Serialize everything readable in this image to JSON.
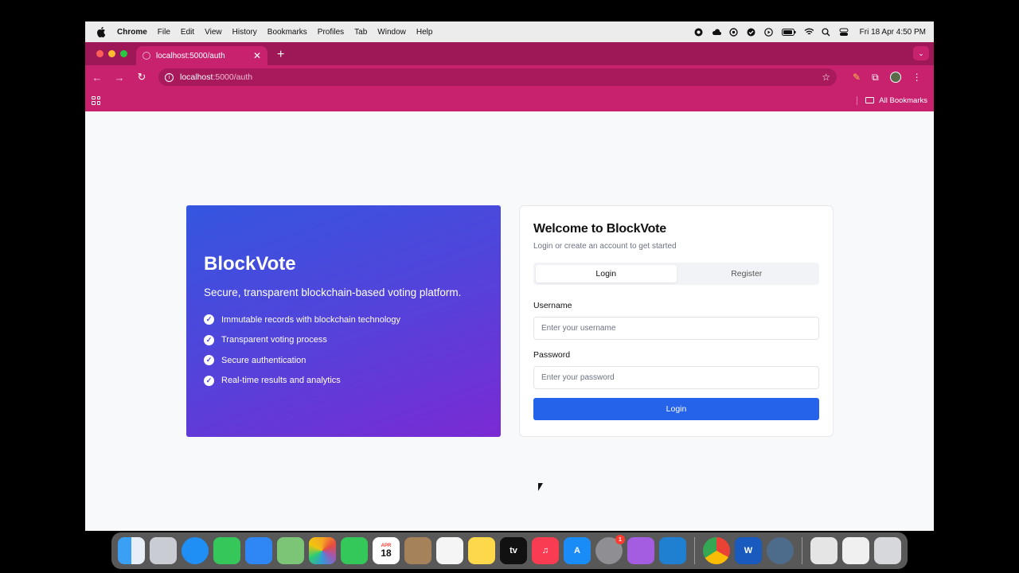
{
  "menubar": {
    "app_name": "Chrome",
    "items": [
      "File",
      "Edit",
      "View",
      "History",
      "Bookmarks",
      "Profiles",
      "Tab",
      "Window",
      "Help"
    ],
    "clock": "Fri 18 Apr  4:50 PM"
  },
  "browser": {
    "tab_title": "localhost:5000/auth",
    "url_host": "localhost",
    "url_path": ":5000/auth",
    "bookmarks_label": "All Bookmarks",
    "accent": "#c8226e"
  },
  "hero": {
    "title": "BlockVote",
    "tagline": "Secure, transparent blockchain-based voting platform.",
    "features": [
      "Immutable records with blockchain technology",
      "Transparent voting process",
      "Secure authentication",
      "Real-time results and analytics"
    ]
  },
  "auth": {
    "title": "Welcome to BlockVote",
    "subtitle": "Login or create an account to get started",
    "tabs": [
      "Login",
      "Register"
    ],
    "username_label": "Username",
    "username_placeholder": "Enter your username",
    "password_label": "Password",
    "password_placeholder": "Enter your password",
    "submit_label": "Login",
    "primary_color": "#2563eb"
  },
  "dock": {
    "calendar_month": "APR",
    "calendar_day": "18",
    "settings_badge": "1",
    "tv_label": "tv"
  }
}
